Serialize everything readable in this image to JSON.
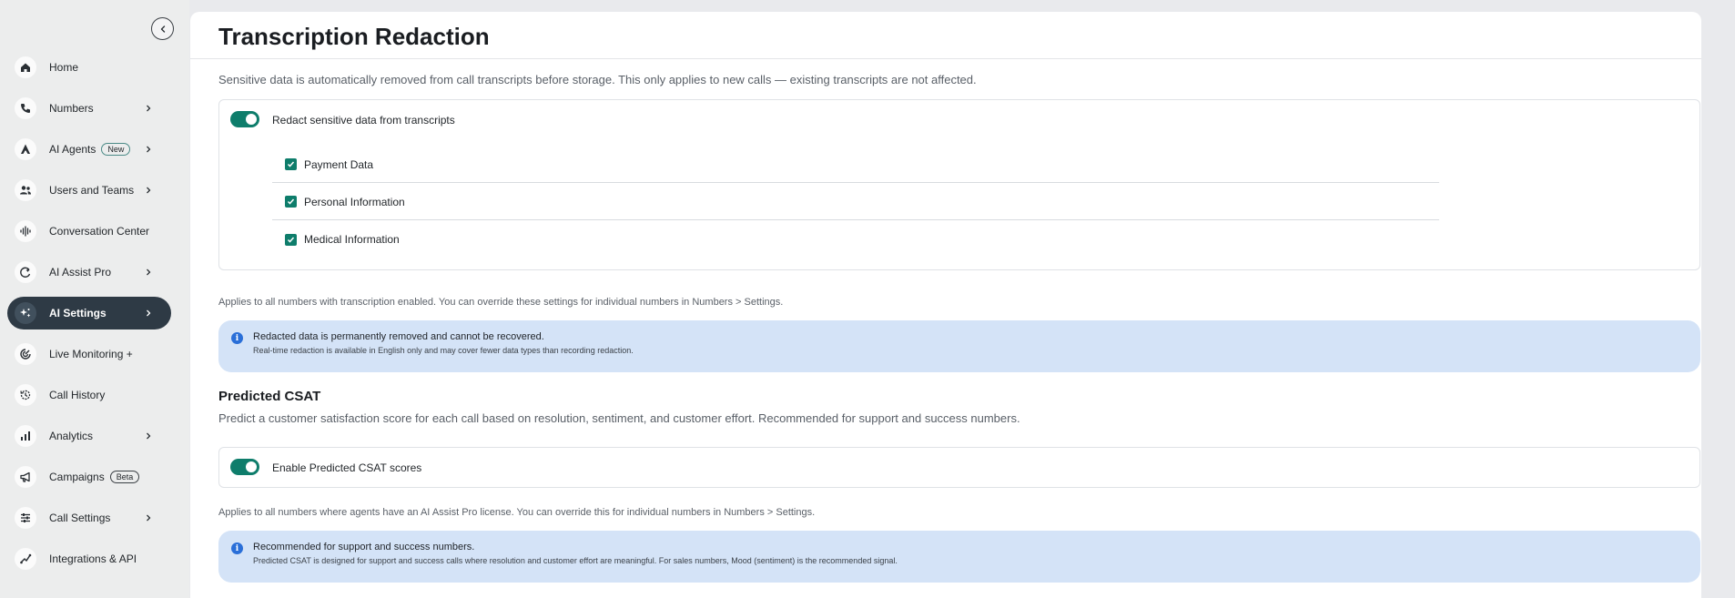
{
  "sidebar": {
    "collapse_icon": "chevron-left-icon",
    "items": [
      {
        "label": "Home",
        "icon": "home-icon",
        "chevron": false,
        "badge": ""
      },
      {
        "label": "Numbers",
        "icon": "phone-icon",
        "chevron": true,
        "badge": ""
      },
      {
        "label": "AI Agents",
        "icon": "ai-agent-icon",
        "chevron": true,
        "badge": "New"
      },
      {
        "label": "Users and Teams",
        "icon": "users-icon",
        "chevron": true,
        "badge": ""
      },
      {
        "label": "Conversation Center",
        "icon": "waveform-icon",
        "chevron": false,
        "badge": ""
      },
      {
        "label": "AI Assist Pro",
        "icon": "assist-icon",
        "chevron": true,
        "badge": ""
      },
      {
        "label": "AI Settings",
        "icon": "sparkle-settings-icon",
        "chevron": true,
        "badge": "",
        "active": true
      },
      {
        "label": "Live Monitoring +",
        "icon": "monitoring-icon",
        "chevron": false,
        "badge": ""
      },
      {
        "label": "Call History",
        "icon": "history-icon",
        "chevron": false,
        "badge": ""
      },
      {
        "label": "Analytics",
        "icon": "analytics-icon",
        "chevron": true,
        "badge": ""
      },
      {
        "label": "Campaigns",
        "icon": "megaphone-icon",
        "chevron": false,
        "badge": "Beta"
      },
      {
        "label": "Call Settings",
        "icon": "sliders-icon",
        "chevron": true,
        "badge": ""
      },
      {
        "label": "Integrations & API",
        "icon": "integrations-icon",
        "chevron": false,
        "badge": ""
      }
    ]
  },
  "page": {
    "title": "Transcription Redaction",
    "redaction": {
      "description": "Sensitive data is automatically removed from call transcripts before storage. This only applies to new calls — existing transcripts are not affected.",
      "toggle_label": "Redact sensitive data from transcripts",
      "toggle_on": true,
      "options": [
        {
          "label": "Payment Data",
          "checked": true
        },
        {
          "label": "Personal Information",
          "checked": true
        },
        {
          "label": "Medical Information",
          "checked": true
        }
      ],
      "note": "Applies to all numbers with transcription enabled. You can override these settings for individual numbers in Numbers > Settings.",
      "info_title": "Redacted data is permanently removed and cannot be recovered.",
      "info_sub": "Real-time redaction is available in English only and may cover fewer data types than recording redaction."
    },
    "csat": {
      "title": "Predicted CSAT",
      "description": "Predict a customer satisfaction score for each call based on resolution, sentiment, and customer effort. Recommended for support and success numbers.",
      "toggle_label": "Enable Predicted CSAT scores",
      "toggle_on": true,
      "note": "Applies to all numbers where agents have an AI Assist Pro license. You can override this for individual numbers in Numbers > Settings.",
      "info_title": "Recommended for support and success numbers.",
      "info_sub": "Predicted CSAT is designed for support and success calls where resolution and customer effort are meaningful. For sales numbers, Mood (sentiment) is the recommended signal."
    }
  },
  "colors": {
    "accent": "#0e7d6b",
    "sidebar_active": "#2e3a45",
    "info_bg": "#d4e3f7",
    "info_icon": "#2a6fd8"
  }
}
